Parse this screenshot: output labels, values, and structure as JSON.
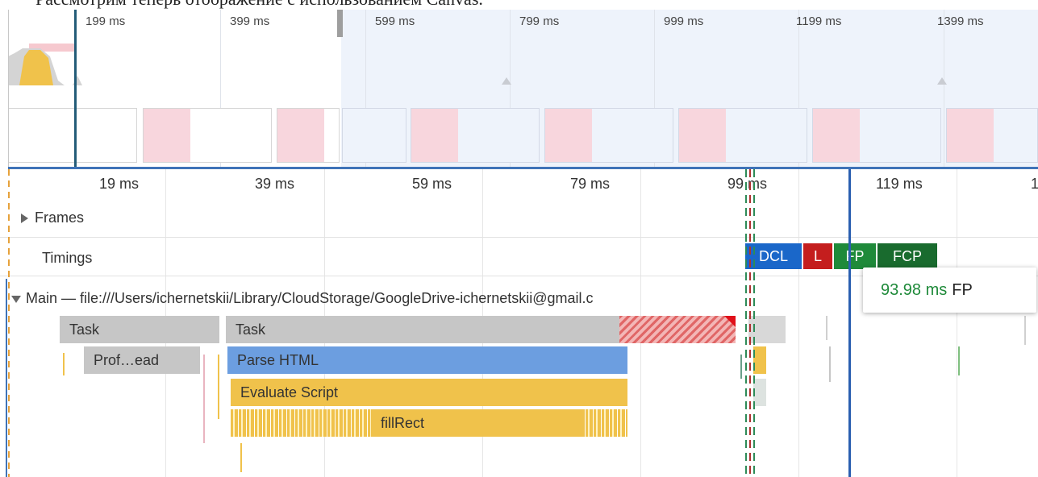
{
  "caption": "Рассмотрим теперь отображение с использованием Canvas.",
  "overview": {
    "ticks": [
      "199 ms",
      "399 ms",
      "599 ms",
      "799 ms",
      "999 ms",
      "1199 ms",
      "1399 ms"
    ]
  },
  "timeline": {
    "ticks": [
      "19 ms",
      "39 ms",
      "59 ms",
      "79 ms",
      "99 ms",
      "119 ms",
      "1"
    ],
    "tracks": {
      "frames": "Frames",
      "timings": "Timings",
      "main": "Main — file:///Users/ichernetskii/Library/CloudStorage/GoogleDrive-ichernetskii@gmail.c"
    },
    "markers": {
      "dcl": "DCL",
      "l": "L",
      "fp": "FP",
      "fcp": "FCP"
    },
    "flame": {
      "task1": "Task",
      "task2": "Task",
      "profile": "Prof…ead",
      "parse_html": "Parse HTML",
      "evaluate_script": "Evaluate Script",
      "fillrect": "fillRect"
    }
  },
  "tooltip": {
    "time": "93.98 ms",
    "label": "FP"
  },
  "colors": {
    "task": "#c6c6c6",
    "parse_html": "#6c9ee0",
    "script": "#f0c24b",
    "dcl": "#1a67c9",
    "load": "#c41e1e",
    "paint": "#1f8a3a",
    "selection": "#eef3fb"
  }
}
